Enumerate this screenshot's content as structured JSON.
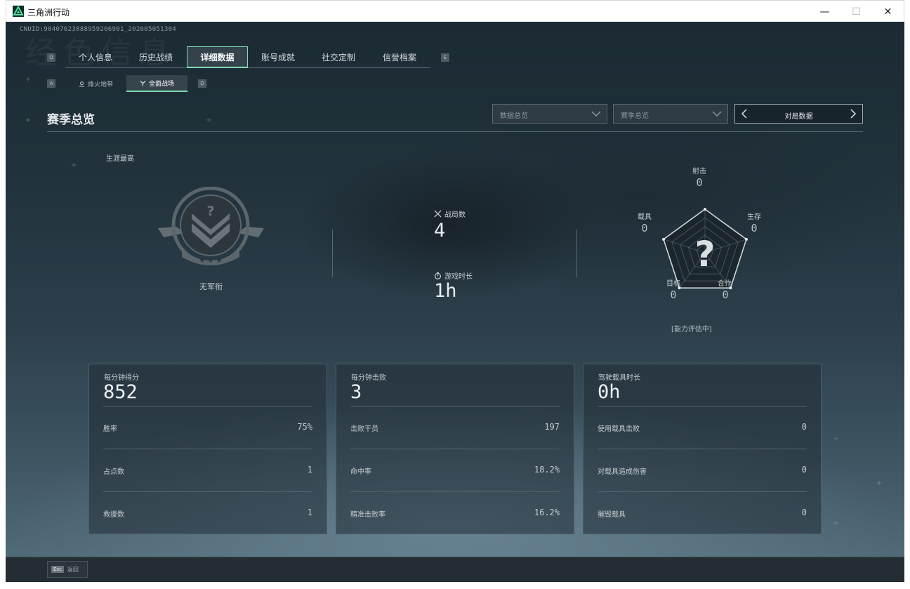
{
  "window": {
    "title": "三角洲行动",
    "min_glyph": "—",
    "max_glyph": "☐",
    "close_glyph": "✕"
  },
  "uid_text": "CNUID:9040762308895920690​1_202605051304",
  "bg_title": "经色信息",
  "keys": {
    "tab_prev": "Q",
    "tab_next": "E",
    "sub_prev": "A",
    "sub_next": "D"
  },
  "tabs": [
    {
      "label": "个人信息",
      "active": false
    },
    {
      "label": "历史战绩",
      "active": false
    },
    {
      "label": "详细数据",
      "active": true
    },
    {
      "label": "账号成就",
      "active": false
    },
    {
      "label": "社交定制",
      "active": false
    },
    {
      "label": "信誉档案",
      "active": false
    }
  ],
  "subtabs": [
    {
      "label": "烽火地带",
      "active": false
    },
    {
      "label": "全面战场",
      "active": true
    }
  ],
  "section_title": "赛季总览",
  "filters": {
    "data_type": "数据总览",
    "season": "赛季总览",
    "mode": "对局数据"
  },
  "career": {
    "label": "生涯最高",
    "rank_name": "无军衔"
  },
  "stats": {
    "matches": {
      "label": "战局数",
      "value": "4"
    },
    "playtime": {
      "label": "游戏时长",
      "value": "1h"
    }
  },
  "radar": {
    "axes": [
      {
        "label": "射击",
        "value": "0"
      },
      {
        "label": "生存",
        "value": "0"
      },
      {
        "label": "合作",
        "value": "0"
      },
      {
        "label": "目标",
        "value": "0"
      },
      {
        "label": "载具",
        "value": "0"
      }
    ],
    "center": "?",
    "note": "[能力评估中]"
  },
  "cards": [
    {
      "title": "每分钟得分",
      "value": "852",
      "rows": [
        {
          "label": "胜率",
          "value": "75%"
        },
        {
          "label": "占点数",
          "value": "1"
        },
        {
          "label": "救援数",
          "value": "1"
        }
      ]
    },
    {
      "title": "每分钟击败",
      "value": "3",
      "rows": [
        {
          "label": "击败干员",
          "value": "197"
        },
        {
          "label": "命中率",
          "value": "18.2%"
        },
        {
          "label": "精准击败率",
          "value": "16.2%"
        }
      ]
    },
    {
      "title": "驾驶载具时长",
      "value": "0h",
      "rows": [
        {
          "label": "使用载具击败",
          "value": "0"
        },
        {
          "label": "对载具造成伤害",
          "value": "0"
        },
        {
          "label": "摧毁载具",
          "value": "0"
        }
      ]
    }
  ],
  "footer": {
    "esc_key": "Esc",
    "back_label": "返回"
  },
  "colors": {
    "accent": "#7eddb1",
    "bg_dark": "#1b2a33"
  }
}
